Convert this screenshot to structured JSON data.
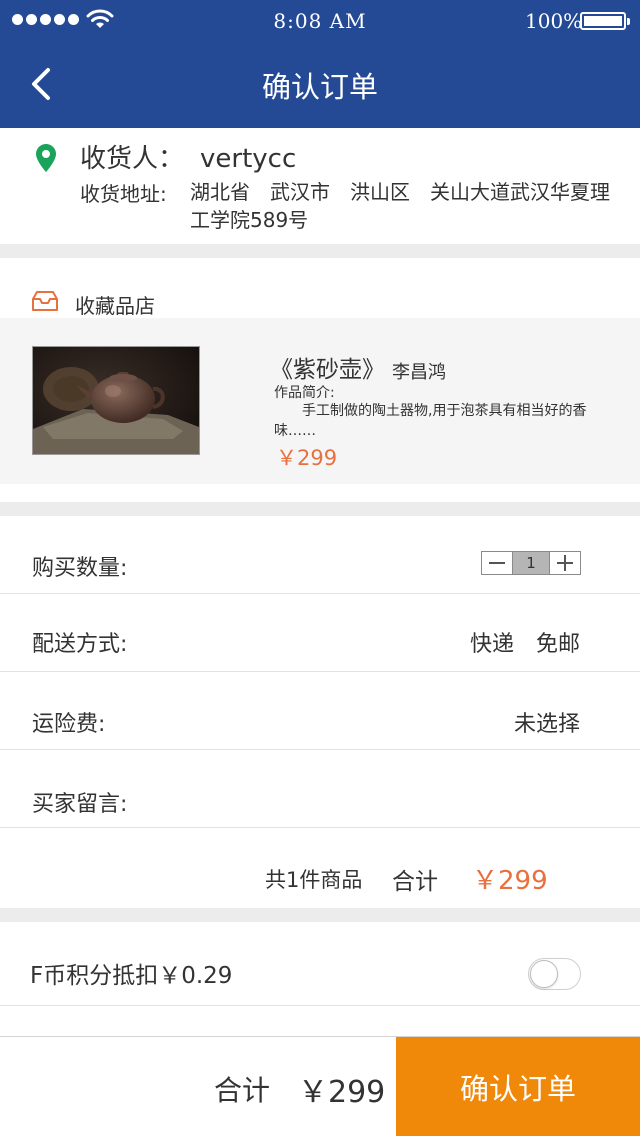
{
  "status_bar": {
    "time": "8:08 AM",
    "battery_percent": "100%",
    "signal_icon": "signal-dots-icon",
    "wifi_icon": "wifi-icon",
    "battery_icon": "battery-icon"
  },
  "nav": {
    "title": "确认订单",
    "back_icon": "chevron-left-icon"
  },
  "address": {
    "receiver_label": "收货人：",
    "receiver_name": "vertycc",
    "address_label": "收货地址:",
    "address_text": "湖北省　武汉市　洪山区　关山大道武汉华夏理工学院589号",
    "icon": "location-pin-icon"
  },
  "shop": {
    "name": "收藏品店",
    "icon": "shop-box-icon"
  },
  "product": {
    "title": "《紫砂壶》",
    "author": "李昌鸿",
    "intro_label": "作品简介:",
    "intro_text": "手工制做的陶土器物,用于泡茶具有相当好的香味……",
    "price": "￥299"
  },
  "rows": {
    "quantity_label": "购买数量:",
    "quantity_value": "1",
    "delivery_label": "配送方式:",
    "delivery_value": "快递　免邮",
    "insurance_label": "运险费:",
    "insurance_value": "未选择",
    "message_label": "买家留言:"
  },
  "summary": {
    "count_text": "共1件商品",
    "total_label": "合计",
    "total_value": "￥299"
  },
  "points": {
    "label": "F币积分抵扣￥0.29",
    "enabled": false
  },
  "bottom_bar": {
    "total_label": "合计",
    "total_value": "￥299",
    "confirm_label": "确认订单"
  },
  "colors": {
    "header_blue": "#244a95",
    "price_orange": "#e8703e",
    "confirm_orange": "#f0880a",
    "pin_green": "#1aa35a"
  }
}
